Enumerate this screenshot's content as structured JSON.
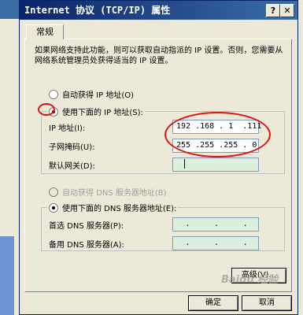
{
  "dialog": {
    "title": "Internet 协议 (TCP/IP) 属性",
    "help_button": "?",
    "close_button": "✕",
    "tab_general": "常规",
    "description": "如果网络支持此功能，则可以获取自动指派的 IP 设置。否则，您需要从网络系统管理员处获得适当的 IP 设置。",
    "auto_ip_label": "自动获得 IP 地址(O)",
    "manual_ip_label": "使用下面的 IP 地址(S):",
    "ip_address_label": "IP 地址(I):",
    "ip_address_value": "192 .168 . 1  .111",
    "subnet_label": "子网掩码(U):",
    "subnet_value": "255 .255 .255 . 0",
    "gateway_label": "默认网关(D):",
    "gateway_value": "",
    "auto_dns_label": "自动获得 DNS 服务器地址(B)",
    "manual_dns_label": "使用下面的 DNS 服务器地址(E):",
    "preferred_dns_label": "首选 DNS 服务器(P):",
    "alternate_dns_label": "备用 DNS 服务器(A):",
    "advanced_button": "高级(V)...",
    "ok_button": "确定",
    "cancel_button": "取消"
  },
  "watermark": "Baidu 经验",
  "selected": {
    "ip_mode": "manual",
    "dns_mode": "manual"
  },
  "colors": {
    "highlight_ellipse": "#dd1111",
    "titlebar": "#0a246a"
  }
}
